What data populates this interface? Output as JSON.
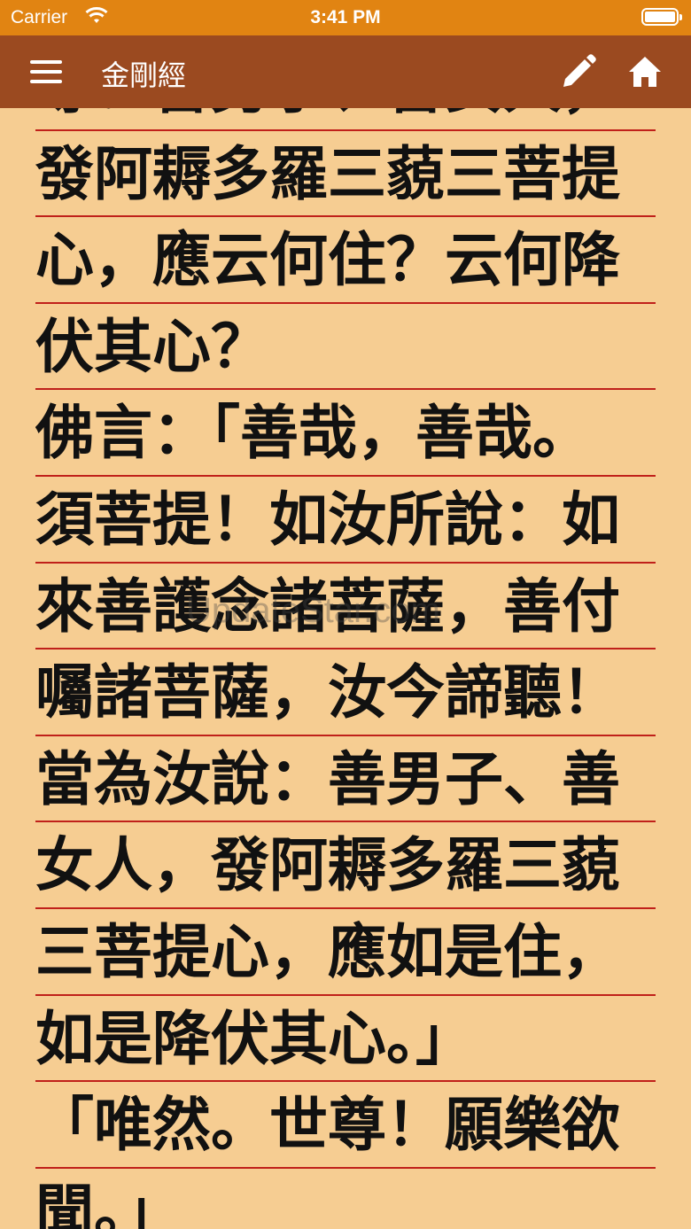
{
  "status": {
    "carrier": "Carrier",
    "time": "3:41 PM"
  },
  "nav": {
    "title": "金剛經"
  },
  "icons": {
    "menu": "hamburger-menu-icon",
    "edit": "pencil-icon",
    "home": "home-icon"
  },
  "colors": {
    "status_bar": "#e18412",
    "nav_bar": "#9b4a20",
    "page": "#f6cd92",
    "rule": "#c0201a"
  },
  "lines": [
    "尊！善男子、善女人，",
    "發阿耨多羅三藐三菩提",
    "心，應云何住？云何降",
    "伏其心？",
    "佛言：「善哉，善哉。",
    "須菩提！如汝所說：如",
    "來善護念諸菩薩，善付",
    "囑諸菩薩，汝今諦聽！",
    "當為汝說：善男子、善",
    "女人，發阿耨多羅三藐",
    "三菩提心，應如是住，",
    "如是降伏其心。」",
    "「唯然。世尊！願樂欲",
    "聞。」"
  ],
  "watermark": "UpdateStar.com"
}
